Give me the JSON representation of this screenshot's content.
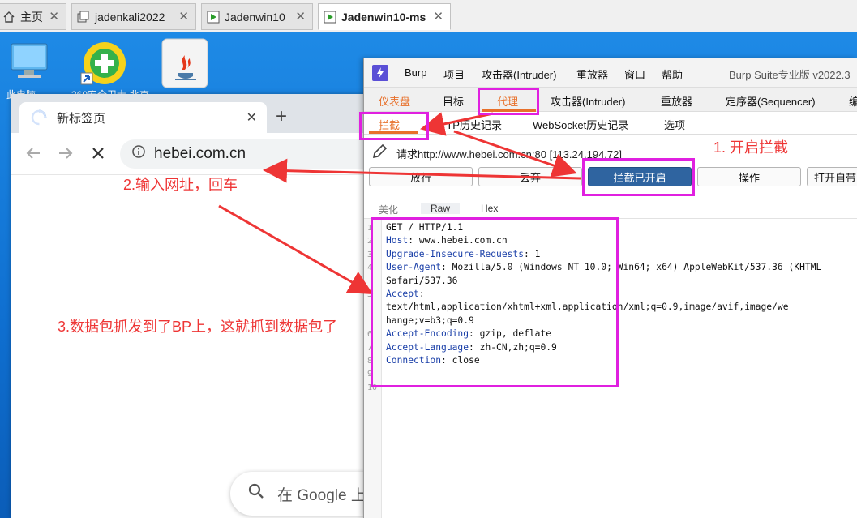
{
  "vm_tabs": [
    {
      "label": "主页",
      "active": false
    },
    {
      "label": "jadenkali2022",
      "active": false
    },
    {
      "label": "Jadenwin10",
      "active": false
    },
    {
      "label": "Jadenwin10-ms",
      "active": true
    }
  ],
  "desktop": {
    "icons": [
      "computer-icon",
      "360-install-icon",
      "java-icon"
    ],
    "partial_labels": [
      "此电脑",
      "360安全卫士-北京"
    ]
  },
  "browser": {
    "tab_title": "新标签页",
    "new_tab_symbol": "+",
    "address": "hebei.com.cn",
    "search_placeholder": "在 Google 上"
  },
  "burp": {
    "menu": [
      "Burp",
      "项目",
      "攻击器(Intruder)",
      "重放器",
      "窗口",
      "帮助"
    ],
    "product_title": "Burp Suite专业版  v2022.3",
    "main_tabs": [
      "仪表盘",
      "目标",
      "代理",
      "攻击器(Intruder)",
      "重放器",
      "定序器(Sequencer)",
      "编"
    ],
    "active_main_tab": "代理",
    "sub_tabs": [
      "拦截",
      "HTTP历史记录",
      "WebSocket历史记录",
      "选项"
    ],
    "active_sub_tab": "拦截",
    "request_label": "请求http://www.hebei.com.cn:80  [113.24.194.72]",
    "buttons": [
      "放行",
      "丢弃",
      "拦截已开启",
      "操作",
      "打开自带"
    ],
    "view_tabs": [
      "美化",
      "Raw",
      "Hex"
    ],
    "active_view_tab": "Raw",
    "request_lines": [
      {
        "n": "1",
        "key": "",
        "val": "GET / HTTP/1.1"
      },
      {
        "n": "2",
        "key": "Host",
        "val": " www.hebei.com.cn"
      },
      {
        "n": "3",
        "key": "Upgrade-Insecure-Requests",
        "val": " 1"
      },
      {
        "n": "4",
        "key": "User-Agent",
        "val": " Mozilla/5.0 (Windows NT 10.0; Win64; x64) AppleWebKit/537.36 (KHTML"
      },
      {
        "n": "",
        "key": "",
        "val": "Safari/537.36"
      },
      {
        "n": "5",
        "key": "Accept",
        "val": ""
      },
      {
        "n": "",
        "key": "",
        "val": "text/html,application/xhtml+xml,application/xml;q=0.9,image/avif,image/we"
      },
      {
        "n": "",
        "key": "",
        "val": "hange;v=b3;q=0.9"
      },
      {
        "n": "6",
        "key": "Accept-Encoding",
        "val": " gzip, deflate"
      },
      {
        "n": "7",
        "key": "Accept-Language",
        "val": " zh-CN,zh;q=0.9"
      },
      {
        "n": "8",
        "key": "Connection",
        "val": " close"
      },
      {
        "n": "9",
        "key": "",
        "val": ""
      },
      {
        "n": "10",
        "key": "",
        "val": ""
      }
    ]
  },
  "annotations": {
    "step1": "1. 开启拦截",
    "step2": "2.输入网址，回车",
    "step3": "3.数据包抓发到了BP上，这就抓到数据包了"
  },
  "colors": {
    "annotation_red": "#ee3535",
    "highlight_magenta": "#e020e0",
    "burp_orange": "#e8702a",
    "burp_button_blue": "#2f64a0"
  }
}
